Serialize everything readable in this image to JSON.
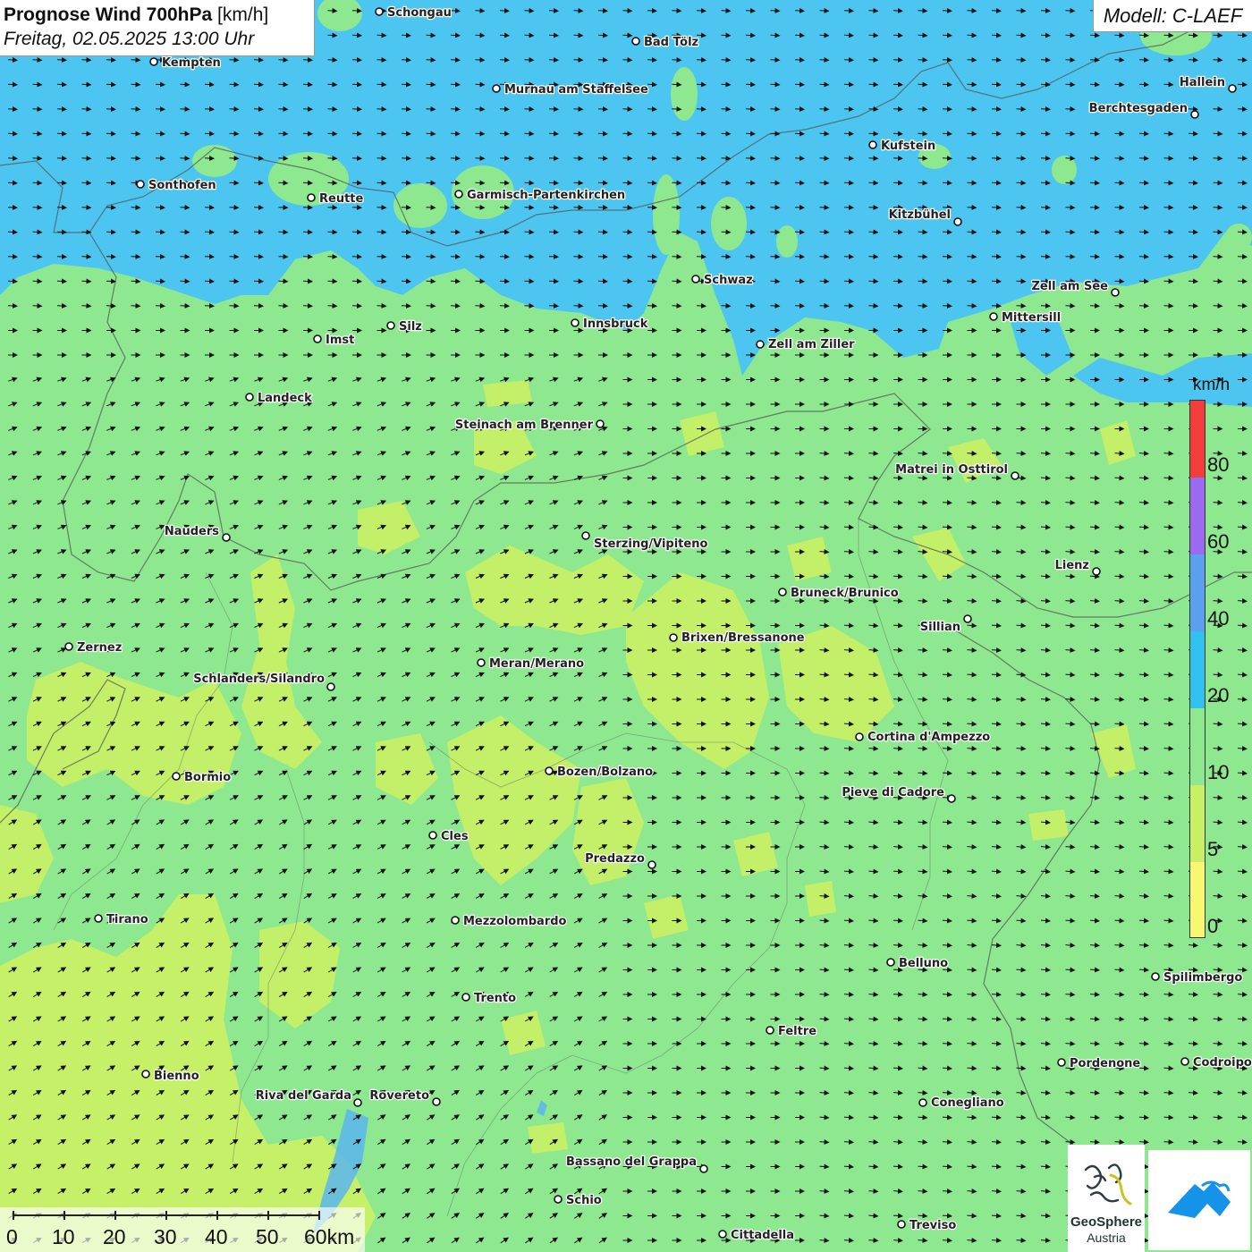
{
  "title": {
    "bold": "Prognose Wind 700hPa",
    "unit": " [km/h]",
    "datetime": "Freitag, 02.05.2025 13:00 Uhr"
  },
  "model": "Modell: C-LAEF",
  "legend": {
    "unit": "km/h",
    "ticks": [
      "80",
      "60",
      "40",
      "20",
      "10",
      "5",
      "0"
    ],
    "colors": [
      "#f33d3d",
      "#9b6af0",
      "#5aa0ef",
      "#31c1ef",
      "#8ee88f",
      "#c9f065",
      "#f8f870"
    ]
  },
  "scale": {
    "labels": [
      "0",
      "10",
      "20",
      "30",
      "40",
      "50",
      "60km"
    ]
  },
  "logos": {
    "geosphere_name": "GeoSphere",
    "geosphere_sub": "Austria"
  },
  "colors": {
    "calm_yellow": "#f2f56a",
    "light_green": "#8ee88f",
    "cyan_blue": "#4cc6f0",
    "sky_blue": "#5ccff5"
  },
  "cities": [
    {
      "name": "Schongau"
    },
    {
      "name": "Bad Tölz"
    },
    {
      "name": "Kempten"
    },
    {
      "name": "Murnau am Staffelsee"
    },
    {
      "name": "Hallein"
    },
    {
      "name": "Berchtesgaden"
    },
    {
      "name": "Kufstein"
    },
    {
      "name": "Sonthofen"
    },
    {
      "name": "Reutte"
    },
    {
      "name": "Garmisch-Partenkirchen"
    },
    {
      "name": "Kitzbühel"
    },
    {
      "name": "Schwaz"
    },
    {
      "name": "Zell am See"
    },
    {
      "name": "Mittersill"
    },
    {
      "name": "Innsbruck"
    },
    {
      "name": "Silz"
    },
    {
      "name": "Imst"
    },
    {
      "name": "Zell am Ziller"
    },
    {
      "name": "Landeck"
    },
    {
      "name": "Steinach am Brenner"
    },
    {
      "name": "Matrei in Osttirol"
    },
    {
      "name": "Nauders"
    },
    {
      "name": "Sterzing/Vipiteno"
    },
    {
      "name": "Lienz"
    },
    {
      "name": "Bruneck/Brunico"
    },
    {
      "name": "Sillian"
    },
    {
      "name": "Brixen/Bressanone"
    },
    {
      "name": "Zernez"
    },
    {
      "name": "Meran/Merano"
    },
    {
      "name": "Schlanders/Silandro"
    },
    {
      "name": "Cortina d'Ampezzo"
    },
    {
      "name": "Bozen/Bolzano"
    },
    {
      "name": "Bormio"
    },
    {
      "name": "Pieve di Cadore"
    },
    {
      "name": "Cles"
    },
    {
      "name": "Predazzo"
    },
    {
      "name": "Tirano"
    },
    {
      "name": "Mezzolombardo"
    },
    {
      "name": "Belluno"
    },
    {
      "name": "Spilimbergo"
    },
    {
      "name": "Trento"
    },
    {
      "name": "Feltre"
    },
    {
      "name": "Pordenone"
    },
    {
      "name": "Codroipo"
    },
    {
      "name": "Bienno"
    },
    {
      "name": "Riva del Garda"
    },
    {
      "name": "Rovereto"
    },
    {
      "name": "Conegliano"
    },
    {
      "name": "Bassano del Grappa"
    },
    {
      "name": "Schio"
    },
    {
      "name": "Treviso"
    },
    {
      "name": "Cittadella"
    }
  ]
}
